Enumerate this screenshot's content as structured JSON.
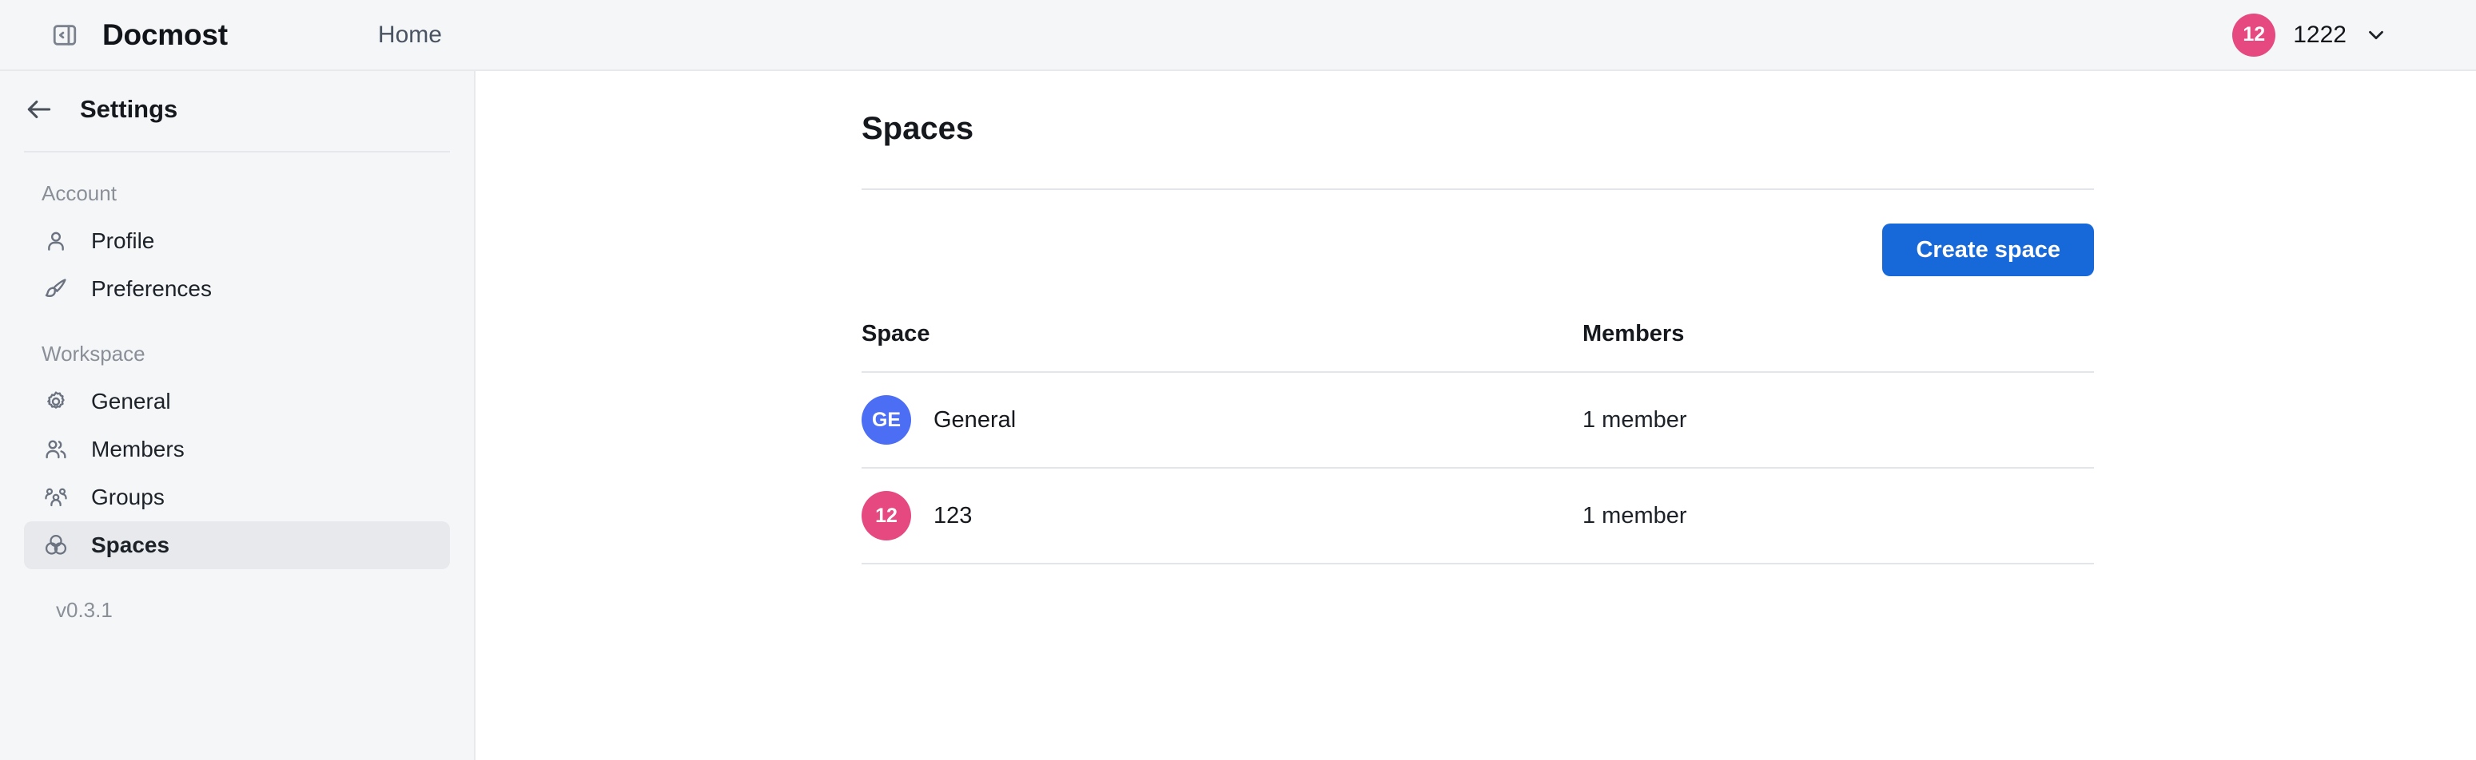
{
  "header": {
    "toggle_icon": "sidebar-toggle-icon",
    "app_title": "Docmost",
    "home_label": "Home",
    "user": {
      "avatar_initials": "12",
      "avatar_color": "#e64980",
      "name": "1222",
      "chevron_icon": "chevron-down-icon"
    }
  },
  "sidebar": {
    "back_icon": "arrow-left-icon",
    "title": "Settings",
    "sections": [
      {
        "label": "Account",
        "items": [
          {
            "label": "Profile",
            "icon": "user-icon",
            "active": false
          },
          {
            "label": "Preferences",
            "icon": "brush-icon",
            "active": false
          }
        ]
      },
      {
        "label": "Workspace",
        "items": [
          {
            "label": "General",
            "icon": "gear-icon",
            "active": false
          },
          {
            "label": "Members",
            "icon": "users-icon",
            "active": false
          },
          {
            "label": "Groups",
            "icon": "users-group-icon",
            "active": false
          },
          {
            "label": "Spaces",
            "icon": "spaces-knot-icon",
            "active": true
          }
        ]
      }
    ],
    "version": "v0.3.1"
  },
  "main": {
    "page_title": "Spaces",
    "create_button": "Create space",
    "accent_color": "#1769da",
    "table": {
      "columns": [
        "Space",
        "Members"
      ],
      "rows": [
        {
          "avatar_initials": "GE",
          "avatar_color": "#4c6ef5",
          "name": "General",
          "members": "1 member"
        },
        {
          "avatar_initials": "12",
          "avatar_color": "#e64980",
          "name": "123",
          "members": "1 member"
        }
      ]
    }
  }
}
